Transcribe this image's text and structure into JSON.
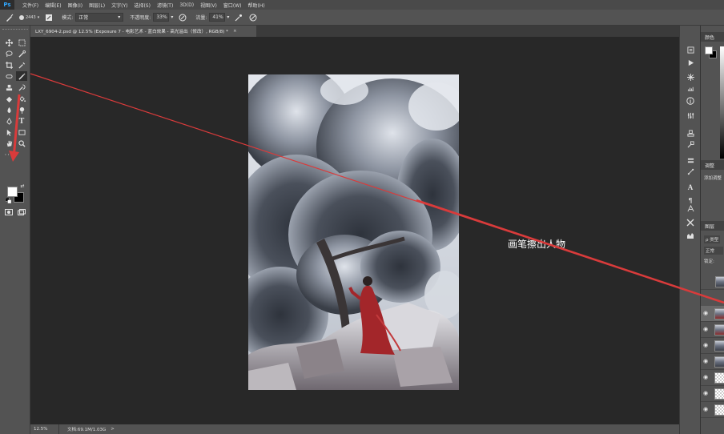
{
  "app": {
    "logo": "Ps"
  },
  "menu": [
    "文件(F)",
    "编辑(E)",
    "图像(I)",
    "图层(L)",
    "文字(Y)",
    "选择(S)",
    "滤镜(T)",
    "3D(D)",
    "视图(V)",
    "窗口(W)",
    "帮助(H)"
  ],
  "options": {
    "brush_size": "2443",
    "mode_label": "模式:",
    "mode_value": "正常",
    "opacity_label": "不透明度:",
    "opacity_value": "33%",
    "flow_label": "流量:",
    "flow_value": "41%"
  },
  "document_tab": {
    "title": "LXY_6904-2.psd @ 12.5% (Exposure 7 - 电影艺术 - 蓝白效果 - 高光溢出（修改）, RGB/8) *",
    "close": "×"
  },
  "annotation": "画笔擦出人物",
  "status": {
    "zoom": "12.5%",
    "doc": "文档:69.1M/1.03G"
  },
  "panels": {
    "color_title": "颜色",
    "adjust_title": "调整",
    "adjust_hint": "添加调整",
    "layers_title": "图层",
    "kind_label": "ρ 类型",
    "blend_mode": "正常",
    "lock_label": "锁定:"
  },
  "colors": {
    "foreground": "#ffffff",
    "background": "#000000",
    "annotation_arrow": "#d93b3b"
  }
}
